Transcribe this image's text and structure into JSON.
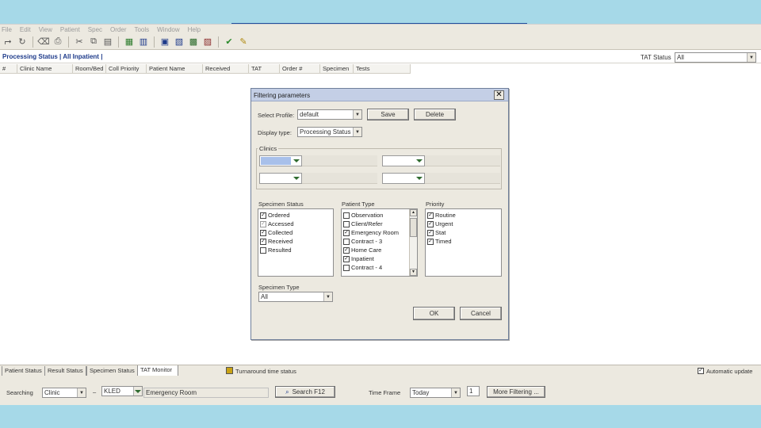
{
  "menu": [
    "File",
    "Edit",
    "View",
    "Patient",
    "Spec",
    "Order",
    "Tools",
    "Window",
    "Help"
  ],
  "toolbar_icons": [
    "open-icon",
    "refresh-icon",
    "clear-icon",
    "print-icon",
    "cut-icon",
    "copy-icon",
    "paste-icon",
    "order-icon",
    "result-icon",
    "patient-icon",
    "label-icon",
    "network-icon",
    "hierarchy-icon",
    "check-icon",
    "collect-icon"
  ],
  "header": {
    "processing_status": "Processing Status | All Inpatient |",
    "tat_status_label": "TAT Status",
    "tat_status_value": "All"
  },
  "columns": [
    "#",
    "Clinic Name",
    "Room/Bed",
    "Coll Priority",
    "Patient Name",
    "Received",
    "TAT",
    "Order #",
    "Specimen",
    "Tests"
  ],
  "dialog": {
    "title": "Filtering parameters",
    "select_profile_label": "Select Profile:",
    "select_profile_value": "default",
    "save_label": "Save",
    "delete_label": "Delete",
    "display_type_label": "Display type:",
    "display_type_value": "Processing Status",
    "clinics_label": "Clinics",
    "specimen_status_label": "Specimen Status",
    "specimen_status": [
      {
        "label": "Ordered",
        "checked": true,
        "gray": false
      },
      {
        "label": "Accessed",
        "checked": true,
        "gray": true
      },
      {
        "label": "Collected",
        "checked": true,
        "gray": false
      },
      {
        "label": "Received",
        "checked": true,
        "gray": false
      },
      {
        "label": "Resulted",
        "checked": false,
        "gray": false
      }
    ],
    "patient_type_label": "Patient Type",
    "patient_type": [
      {
        "label": "Observation",
        "checked": false
      },
      {
        "label": "Client/Refer",
        "checked": false
      },
      {
        "label": "Emergency Room",
        "checked": true
      },
      {
        "label": "Contract - 3",
        "checked": false
      },
      {
        "label": "Home Care",
        "checked": true
      },
      {
        "label": "Inpatient",
        "checked": true
      },
      {
        "label": "Contract - 4",
        "checked": false
      }
    ],
    "priority_label": "Priority",
    "priority": [
      {
        "label": "Routine",
        "checked": true
      },
      {
        "label": "Urgent",
        "checked": true
      },
      {
        "label": "Stat",
        "checked": true
      },
      {
        "label": "Timed",
        "checked": true
      }
    ],
    "specimen_type_label": "Specimen Type",
    "specimen_type_value": "All",
    "ok_label": "OK",
    "cancel_label": "Cancel"
  },
  "tabs": [
    "Patient Status",
    "Result Status",
    "Specimen Status",
    "TAT Monitor"
  ],
  "status_bar": {
    "turnaround_label": "Turnaround time status",
    "automatic_update_label": "Automatic update"
  },
  "search_bar": {
    "searching_label": "Searching",
    "searching_value": "Clinic",
    "clinic_code": "KLED",
    "clinic_name": "Emergency Room",
    "search_button": "Search F12",
    "time_frame_label": "Time Frame",
    "time_frame_value": "Today",
    "count_value": "1",
    "more_filtering_button": "More Filtering ..."
  }
}
